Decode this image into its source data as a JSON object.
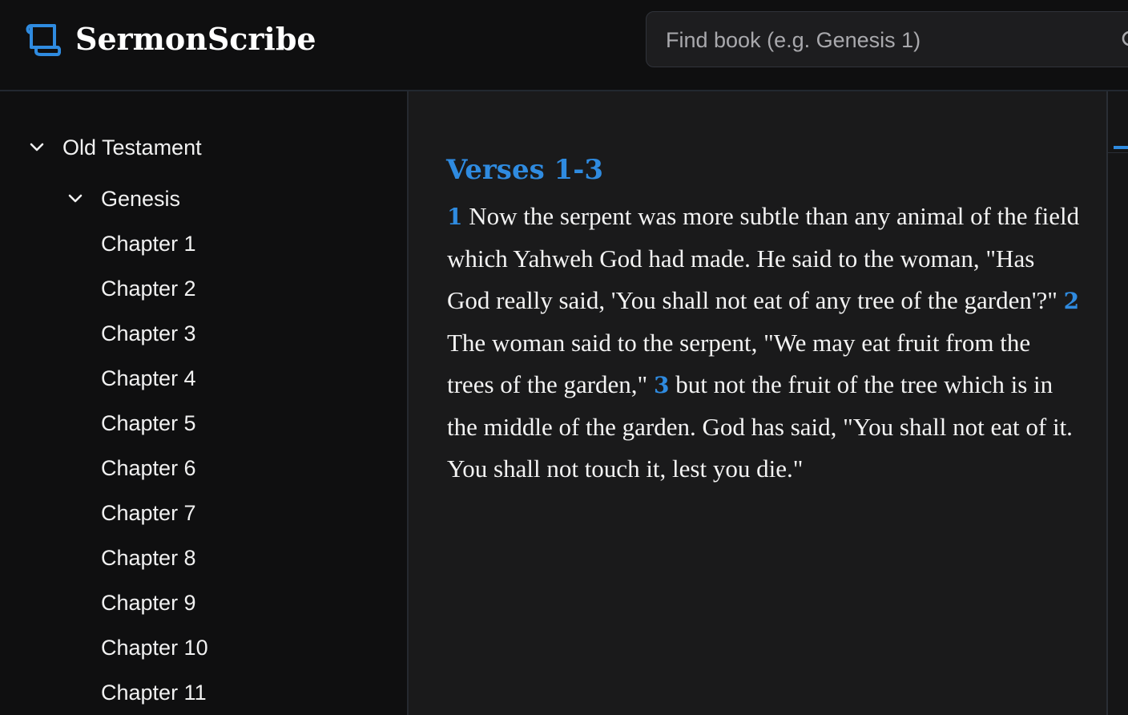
{
  "app": {
    "name": "SermonScribe",
    "logo_icon": "scroll-icon",
    "accent_color": "#2f8be0"
  },
  "search": {
    "placeholder": "Find book (e.g. Genesis 1)",
    "value": "",
    "icon": "search-icon"
  },
  "sidebar": {
    "testament": {
      "label": "Old Testament",
      "expanded": true,
      "icon": "chevron-down-icon"
    },
    "book": {
      "label": "Genesis",
      "expanded": true,
      "icon": "chevron-down-icon"
    },
    "chapters": [
      "Chapter 1",
      "Chapter 2",
      "Chapter 3",
      "Chapter 4",
      "Chapter 5",
      "Chapter 6",
      "Chapter 7",
      "Chapter 8",
      "Chapter 9",
      "Chapter 10",
      "Chapter 11"
    ]
  },
  "main": {
    "section_title": "Verses 1-3",
    "verses": [
      {
        "number": "1",
        "text": "Now the serpent was more subtle than any animal of the field which Yahweh God had made. He said to the woman, \"Has God really said, 'You shall not eat of any tree of the garden'?\""
      },
      {
        "number": "2",
        "text": "The woman said to the serpent, \"We may eat fruit from the trees of the garden,\""
      },
      {
        "number": "3",
        "text": "but not the fruit of the tree which is in the middle of the garden. God has said, \"You shall not eat of it. You shall not touch it, lest you die.\""
      }
    ]
  }
}
